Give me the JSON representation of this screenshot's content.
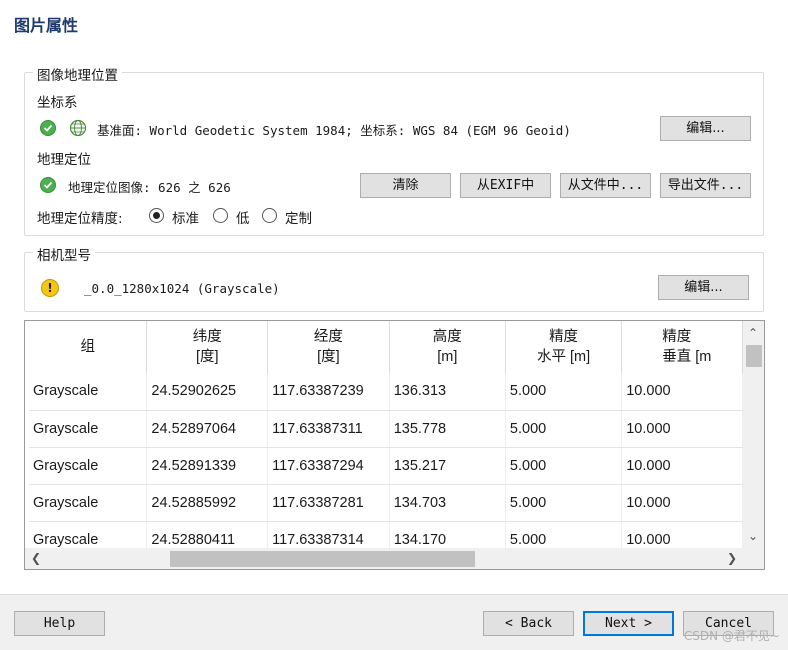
{
  "page_title": "图片属性",
  "geo_group": {
    "title": "图像地理位置",
    "coord_section_label": "坐标系",
    "coord_text": "基准面: World Geodetic System 1984; 坐标系: WGS 84 (EGM 96 Geoid)",
    "coord_edit_label": "编辑...",
    "geoloc_section_label": "地理定位",
    "geoloc_text": "地理定位图像: 626 之 626",
    "clear_label": "清除",
    "from_exif_label": "从EXIF中",
    "from_file_label": "从文件中...",
    "export_file_label": "导出文件...",
    "accuracy_label": "地理定位精度:",
    "accuracy_options": [
      "标准",
      "低",
      "定制"
    ],
    "accuracy_selected": "标准"
  },
  "camera_group": {
    "title": "相机型号",
    "model_text": "_0.0_1280x1024 (Grayscale)",
    "edit_label": "编辑..."
  },
  "table": {
    "headers": [
      [
        "组",
        ""
      ],
      [
        "纬度",
        "[度]"
      ],
      [
        "经度",
        "[度]"
      ],
      [
        "高度",
        "[m]"
      ],
      [
        "精度",
        "水平 [m]"
      ],
      [
        "精度",
        "垂直 [m"
      ]
    ],
    "rows": [
      [
        "Grayscale",
        "24.52902625",
        "117.63387239",
        "136.313",
        "5.000",
        "10.000"
      ],
      [
        "Grayscale",
        "24.52897064",
        "117.63387311",
        "135.778",
        "5.000",
        "10.000"
      ],
      [
        "Grayscale",
        "24.52891339",
        "117.63387294",
        "135.217",
        "5.000",
        "10.000"
      ],
      [
        "Grayscale",
        "24.52885992",
        "117.63387281",
        "134.703",
        "5.000",
        "10.000"
      ],
      [
        "Grayscale",
        "24.52880411",
        "117.63387314",
        "134.170",
        "5.000",
        "10.000"
      ]
    ]
  },
  "footer": {
    "help_label": "Help",
    "back_label": "< Back",
    "next_label": "Next >",
    "cancel_label": "Cancel",
    "watermark": "CSDN @君不见~"
  },
  "icons": {
    "ok": "check-circle-icon",
    "globe": "globe-icon",
    "warning": "warning-icon"
  }
}
